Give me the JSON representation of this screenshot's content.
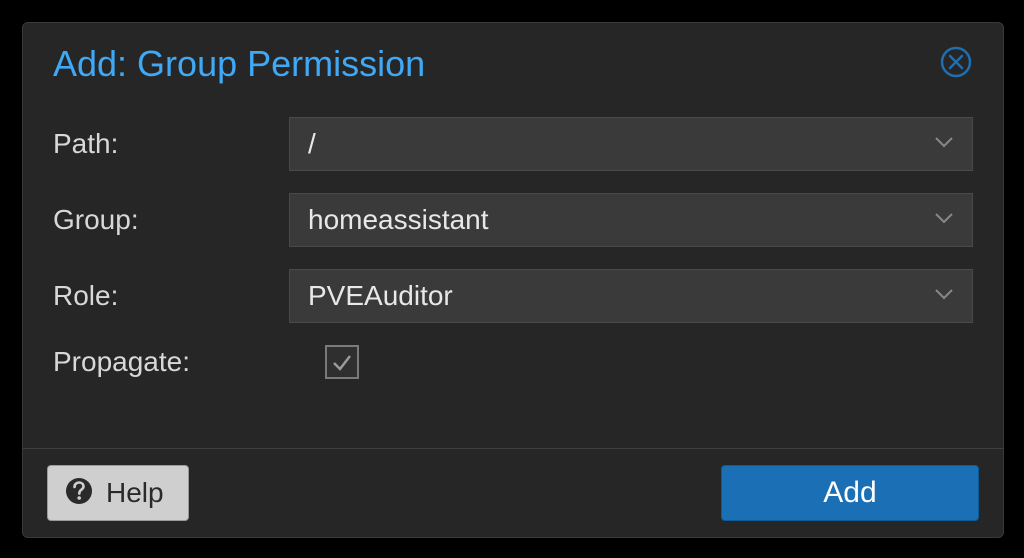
{
  "dialog": {
    "title": "Add: Group Permission",
    "fields": {
      "path_label": "Path:",
      "path_value": "/",
      "group_label": "Group:",
      "group_value": "homeassistant",
      "role_label": "Role:",
      "role_value": "PVEAuditor",
      "propagate_label": "Propagate:",
      "propagate_checked": true
    },
    "buttons": {
      "help": "Help",
      "add": "Add"
    }
  }
}
